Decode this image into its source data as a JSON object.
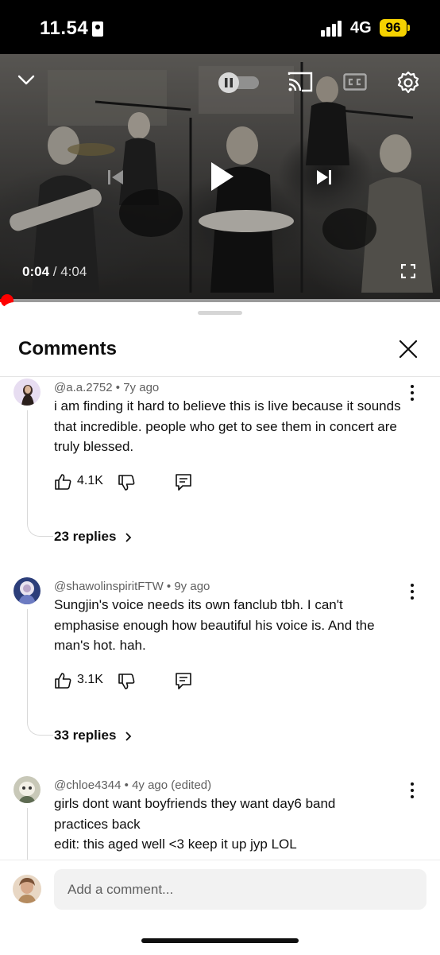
{
  "status_bar": {
    "time": "11.54",
    "network": "4G",
    "battery": "96"
  },
  "player": {
    "current_time": "0:04",
    "separator": " / ",
    "total_time": "4:04",
    "progress_fraction": 0.017
  },
  "comments_panel": {
    "title": "Comments",
    "comments": [
      {
        "author": "@a.a.2752",
        "age": "7y ago",
        "text": "i am finding it hard to believe this is live because it sounds that incredible. people who get to see them in concert are truly blessed.",
        "likes": "4.1K",
        "replies": "23 replies"
      },
      {
        "author": "@shawolinspiritFTW",
        "age": "9y ago",
        "text": "Sungjin's voice needs its own fanclub tbh. I can't emphasise enough how beautiful his voice is. And the man's hot. hah.",
        "likes": "3.1K",
        "replies": "33 replies"
      },
      {
        "author": "@chloe4344",
        "age": "4y ago (edited)",
        "text_lines": [
          "girls dont want boyfriends they want day6 band",
          "practices back",
          "edit: this aged well <3 keep it up jyp LOL"
        ]
      }
    ]
  },
  "composer": {
    "placeholder": "Add a comment..."
  },
  "icons": {
    "collapse": "chevron-down-icon",
    "autoplay": "autoplay-toggle-icon",
    "cast": "cast-icon",
    "captions": "captions-icon",
    "settings": "gear-icon",
    "previous": "skip-previous-icon",
    "play": "play-icon",
    "next": "skip-next-icon",
    "fullscreen": "fullscreen-icon",
    "close": "close-icon",
    "more": "more-vertical-icon",
    "like": "thumbs-up-icon",
    "dislike": "thumbs-down-icon",
    "reply": "reply-icon"
  },
  "colors": {
    "accent": "#ff0000",
    "battery": "#f5d200",
    "text_secondary": "#606060"
  }
}
